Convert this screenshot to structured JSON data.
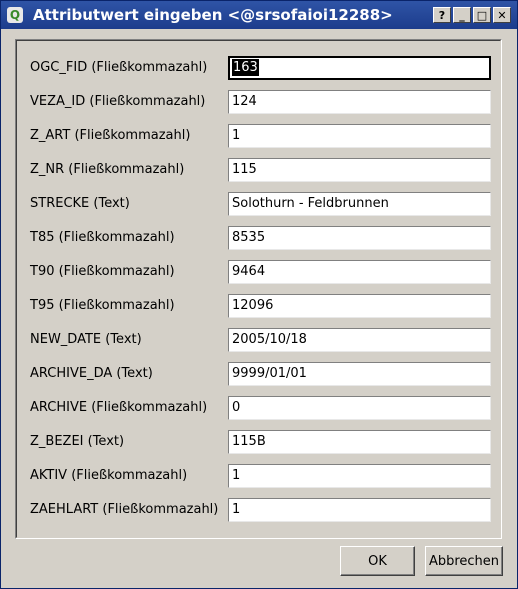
{
  "window": {
    "title": "Attributwert eingeben <@srsofaioi12288>",
    "app_icon_letter": "Q",
    "controls": {
      "help": "?",
      "minimize": "_",
      "maximize": "□",
      "close": "✕"
    }
  },
  "fields": [
    {
      "label": "OGC_FID (Fließkommazahl)",
      "value": "163"
    },
    {
      "label": "VEZA_ID (Fließkommazahl)",
      "value": "124"
    },
    {
      "label": "Z_ART (Fließkommazahl)",
      "value": "1"
    },
    {
      "label": "Z_NR (Fließkommazahl)",
      "value": "115"
    },
    {
      "label": "STRECKE (Text)",
      "value": "Solothurn - Feldbrunnen"
    },
    {
      "label": "T85 (Fließkommazahl)",
      "value": "8535"
    },
    {
      "label": "T90 (Fließkommazahl)",
      "value": "9464"
    },
    {
      "label": "T95 (Fließkommazahl)",
      "value": "12096"
    },
    {
      "label": "NEW_DATE (Text)",
      "value": "2005/10/18"
    },
    {
      "label": "ARCHIVE_DA (Text)",
      "value": "9999/01/01"
    },
    {
      "label": "ARCHIVE (Fließkommazahl)",
      "value": "0"
    },
    {
      "label": "Z_BEZEI (Text)",
      "value": "115B"
    },
    {
      "label": "AKTIV (Fließkommazahl)",
      "value": "1"
    },
    {
      "label": "ZAEHLART (Fließkommazahl)",
      "value": "1"
    }
  ],
  "buttons": {
    "ok": "OK",
    "cancel": "Abbrechen"
  },
  "colors": {
    "titlebar": "#1c3c8c",
    "selection": "#000000"
  }
}
